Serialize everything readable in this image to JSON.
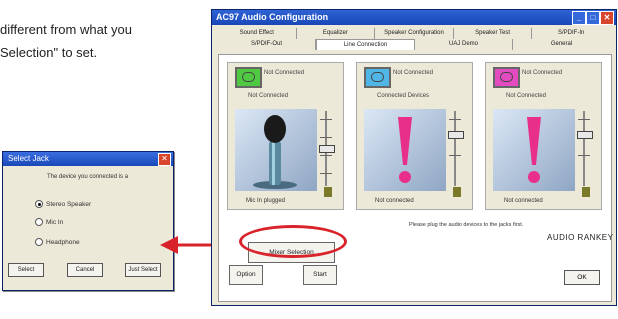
{
  "doc": {
    "line1": "different from what you",
    "line2": "Selection\" to set."
  },
  "dialog": {
    "title": "Select Jack",
    "message": "The device you connected is a",
    "options": [
      "Stereo Speaker",
      "Mic In",
      "Headphone"
    ],
    "selected_index": 0,
    "buttons": [
      "Select",
      "Cancel",
      "Just Select"
    ]
  },
  "window": {
    "title": "AC97 Audio Configuration",
    "tabs_row1": [
      "Sound Effect",
      "Equalizer",
      "Speaker Configuration",
      "Speaker Test",
      "S/PDIF-In"
    ],
    "tabs_row2": [
      "S/PDIF-Out",
      "Line Connection",
      "UAJ Demo",
      "General"
    ],
    "active_tab": "Line Connection",
    "panels": [
      {
        "title": "Not Connected",
        "combo": "Not Connected",
        "status": "Mic In plugged",
        "jack_color": "#4fc842"
      },
      {
        "title": "Not Connected",
        "combo": "Connected Devices",
        "status": "Not connected",
        "jack_color": "#4fb6e6"
      },
      {
        "title": "Not Connected",
        "combo": "Not Connected",
        "status": "Not connected",
        "jack_color": "#e34cc0"
      }
    ],
    "mixer_button": "Mixer Selection",
    "option_button": "Option",
    "start_button": "Start",
    "note": "Please plug the audio devices to the jacks first.",
    "brand": "AUDIO RANKEY",
    "ok_button": "OK"
  },
  "colors": {
    "highlight": "#d8232a",
    "arrow": "#d8232a",
    "title_bar": "#1f4fc0"
  }
}
